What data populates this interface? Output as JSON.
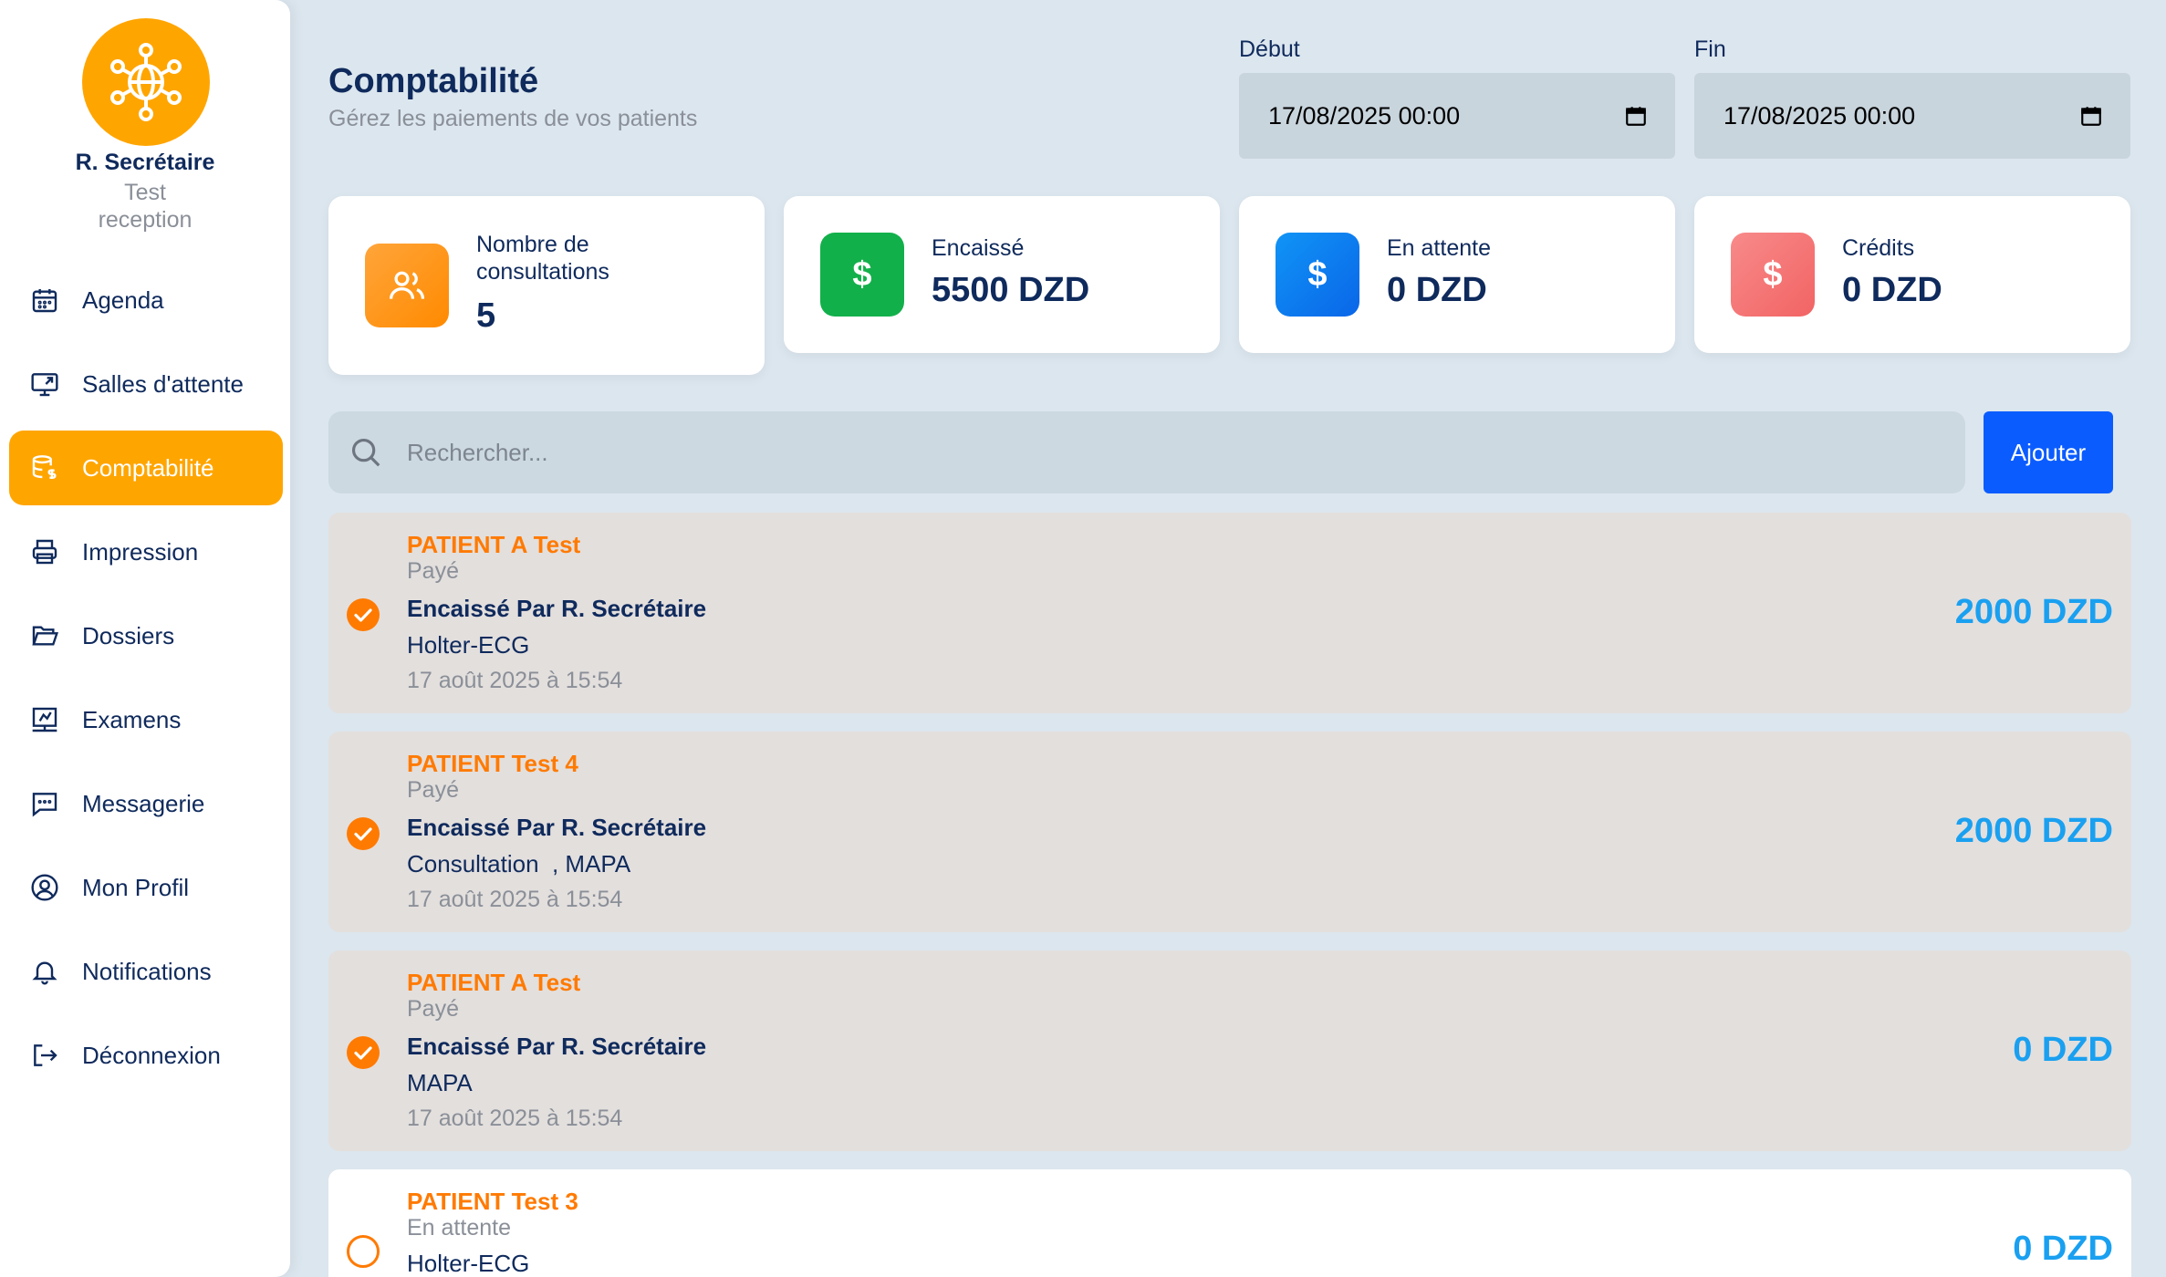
{
  "user": {
    "name": "R. Secrétaire",
    "role_line1": "Test",
    "role_line2": "reception"
  },
  "nav": [
    {
      "label": "Agenda",
      "icon": "calendar-icon",
      "active": false
    },
    {
      "label": "Salles d'attente",
      "icon": "monitor-icon",
      "active": false
    },
    {
      "label": "Comptabilité",
      "icon": "database-dollar-icon",
      "active": true
    },
    {
      "label": "Impression",
      "icon": "printer-icon",
      "active": false
    },
    {
      "label": "Dossiers",
      "icon": "folder-open-icon",
      "active": false
    },
    {
      "label": "Examens",
      "icon": "presentation-icon",
      "active": false
    },
    {
      "label": "Messagerie",
      "icon": "message-icon",
      "active": false
    },
    {
      "label": "Mon Profil",
      "icon": "user-circle-icon",
      "active": false
    },
    {
      "label": "Notifications",
      "icon": "bell-icon",
      "active": false
    },
    {
      "label": "Déconnexion",
      "icon": "logout-icon",
      "active": false
    }
  ],
  "header": {
    "title": "Comptabilité",
    "subtitle": "Gérez les paiements de vos patients",
    "start_label": "Début",
    "start_value": "17/08/2025 00:00",
    "end_label": "Fin",
    "end_value": "17/08/2025 00:00"
  },
  "stats": {
    "consultations": {
      "label_line1": "Nombre de",
      "label_line2": "consultations",
      "value": "5",
      "color": "#ff9a1a"
    },
    "collected": {
      "label": "Encaissé",
      "value": "5500 DZD",
      "color": "#12b04a"
    },
    "pending": {
      "label": "En attente",
      "value": "0 DZD",
      "color": "#0a7cf0"
    },
    "credits": {
      "label": "Crédits",
      "value": "0 DZD",
      "color": "#f57373"
    }
  },
  "search": {
    "placeholder": "Rechercher..."
  },
  "add_button": "Ajouter",
  "payments": [
    {
      "patient": "PATIENT A Test",
      "status": "Payé",
      "collected_by": "Encaissé Par R. Secrétaire",
      "service": "Holter-ECG",
      "date": "17 août 2025 à 15:54",
      "amount": "2000 DZD",
      "paid": true
    },
    {
      "patient": "PATIENT Test 4",
      "status": "Payé",
      "collected_by": "Encaissé Par R. Secrétaire",
      "service": "Consultation  , MAPA",
      "date": "17 août 2025 à 15:54",
      "amount": "2000 DZD",
      "paid": true
    },
    {
      "patient": "PATIENT A Test",
      "status": "Payé",
      "collected_by": "Encaissé Par R. Secrétaire",
      "service": "MAPA",
      "date": "17 août 2025 à 15:54",
      "amount": "0 DZD",
      "paid": true
    },
    {
      "patient": "PATIENT Test 3",
      "status": "En attente",
      "service": "Holter-ECG",
      "amount": "0 DZD",
      "paid": false
    }
  ],
  "colors": {
    "accent": "#ffa500",
    "primary": "#0a5cff",
    "navy": "#0f2a5c",
    "patient_name": "#ff7a00",
    "amount": "#1aa0f0"
  }
}
